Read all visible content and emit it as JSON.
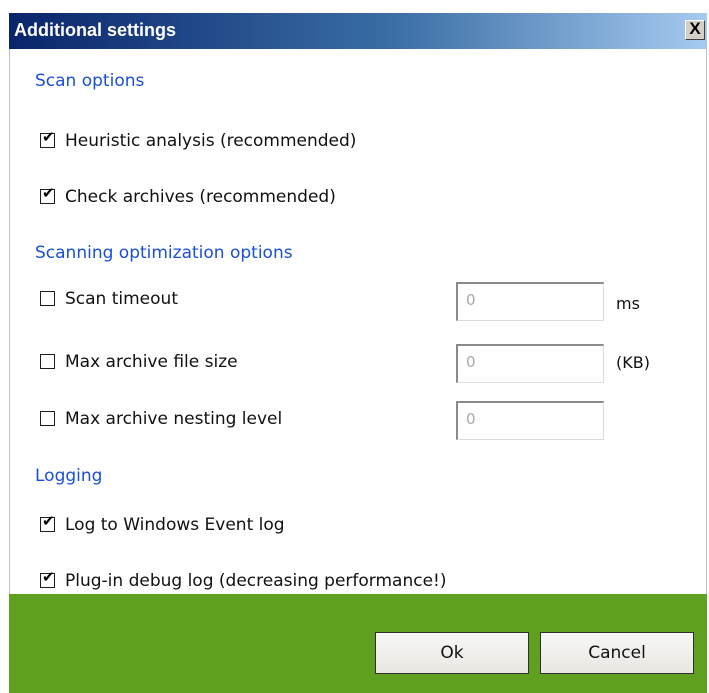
{
  "window": {
    "title": "Additional settings",
    "close_glyph": "X"
  },
  "sections": {
    "scan_options": "Scan options",
    "optimization": "Scanning optimization options",
    "logging": "Logging"
  },
  "scan_options": {
    "heuristic": {
      "label": "Heuristic analysis (recommended)",
      "checked": true
    },
    "archives": {
      "label": "Check archives (recommended)",
      "checked": true
    }
  },
  "optimization": {
    "timeout": {
      "label": "Scan timeout",
      "checked": false,
      "value": "0",
      "unit": "ms"
    },
    "max_size": {
      "label": "Max archive file size",
      "checked": false,
      "value": "0",
      "unit": "(KB)"
    },
    "nesting": {
      "label": "Max archive nesting level",
      "checked": false,
      "value": "0"
    }
  },
  "logging": {
    "event_log": {
      "label": "Log to Windows Event log",
      "checked": true
    },
    "debug_log": {
      "label": "Plug-in debug log (decreasing performance!)",
      "checked": true
    }
  },
  "buttons": {
    "ok": "Ok",
    "cancel": "Cancel"
  },
  "colors": {
    "title_bar": "#0a246a",
    "section_text": "#1a4fd6",
    "footer": "#5fa020"
  }
}
